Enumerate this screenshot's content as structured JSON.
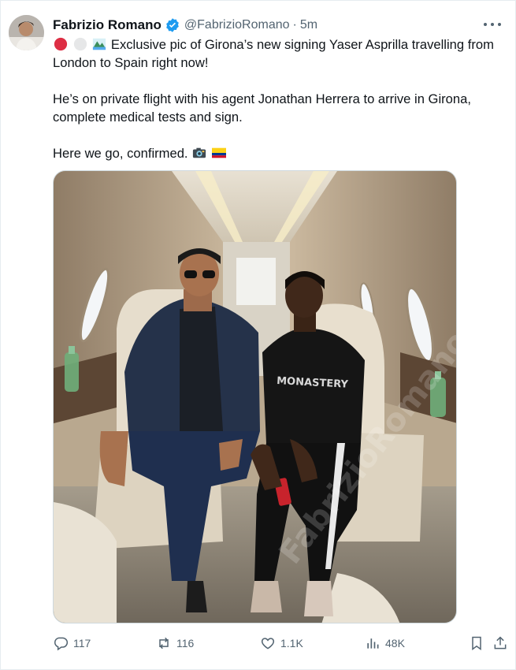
{
  "author": {
    "name": "Fabrizio Romano",
    "handle": "@FabrizioRomano",
    "separator": "·",
    "time": "5m",
    "verified": true
  },
  "tweet": {
    "line1_text": "Exclusive pic of Girona’s new signing Yaser Asprilla travelling from London to Spain right now!",
    "line2_text": "He’s on private flight with his agent Jonathan Herrera to arrive in Girona, complete medical tests and sign.",
    "line3_text": "Here we go, confirmed.",
    "leading_emojis": [
      "red-circle-emoji",
      "white-circle-emoji",
      "mountain-emoji"
    ],
    "trailing_emojis": [
      "camera-emoji",
      "colombia-flag-emoji"
    ]
  },
  "media": {
    "watermark": "FabrizioRomano"
  },
  "actions": {
    "replies": "117",
    "reposts": "116",
    "likes": "1.1K",
    "views": "48K"
  },
  "colors": {
    "text": "#0f1419",
    "secondary": "#536471",
    "verified": "#1d9bf0",
    "border": "#cfd9de"
  }
}
